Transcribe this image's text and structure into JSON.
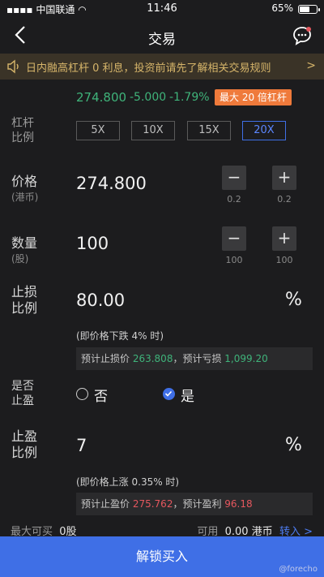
{
  "status": {
    "carrier": "中国联通",
    "time": "11:46",
    "battery": "65%",
    "battery_level": 0.65
  },
  "nav": {
    "title": "交易"
  },
  "banner": {
    "text": "日内融高杠杆 0 利息，投资前请先了解相关交易规则",
    "arrow": ">"
  },
  "quote": {
    "price": "274.800",
    "change": "-5.000",
    "pct": "-1.79%",
    "badge": "最大 20 倍杠杆"
  },
  "leverage": {
    "label_line1": "杠杆",
    "label_line2": "比例",
    "options": [
      "5X",
      "10X",
      "15X",
      "20X"
    ],
    "selected": "20X"
  },
  "price": {
    "label": "价格",
    "unit": "(港币)",
    "value": "274.800",
    "minus": "−",
    "plus": "+",
    "minus_step": "0.2",
    "plus_step": "0.2"
  },
  "quantity": {
    "label": "数量",
    "unit": "(股)",
    "value": "100",
    "minus": "−",
    "plus": "+",
    "minus_step": "100",
    "plus_step": "100"
  },
  "stop_loss": {
    "label_line1": "止损",
    "label_line2": "比例",
    "value": "80.00",
    "pct": "%",
    "hint": "(即价格下跌 4% 时)",
    "info_prefix": "预计止损价 ",
    "info_price": "263.808",
    "info_mid": "，预计亏损 ",
    "info_loss": "1,099.20"
  },
  "take_profit_toggle": {
    "label_line1": "是否",
    "label_line2": "止盈",
    "no_label": "否",
    "yes_label": "是",
    "selected": "是"
  },
  "take_profit": {
    "label_line1": "止盈",
    "label_line2": "比例",
    "value": "7",
    "pct": "%",
    "hint": "(即价格上涨 0.35% 时)",
    "info_prefix": "预计止盈价 ",
    "info_price": "275.762",
    "info_mid": "，预计盈利 ",
    "info_profit": "96.18"
  },
  "bottom": {
    "max_buy_label": "最大可买",
    "max_buy_value": "0股",
    "available_label": "可用",
    "available_value": "0.00 港币",
    "transfer_label": "转入",
    "transfer_arrow": ">"
  },
  "submit": {
    "label": "解锁买入"
  },
  "watermark": "@forecho",
  "colors": {
    "accent": "#3f6fe6",
    "down": "#3fb37a",
    "up": "#e5575e",
    "badge": "#ef7a3b"
  }
}
